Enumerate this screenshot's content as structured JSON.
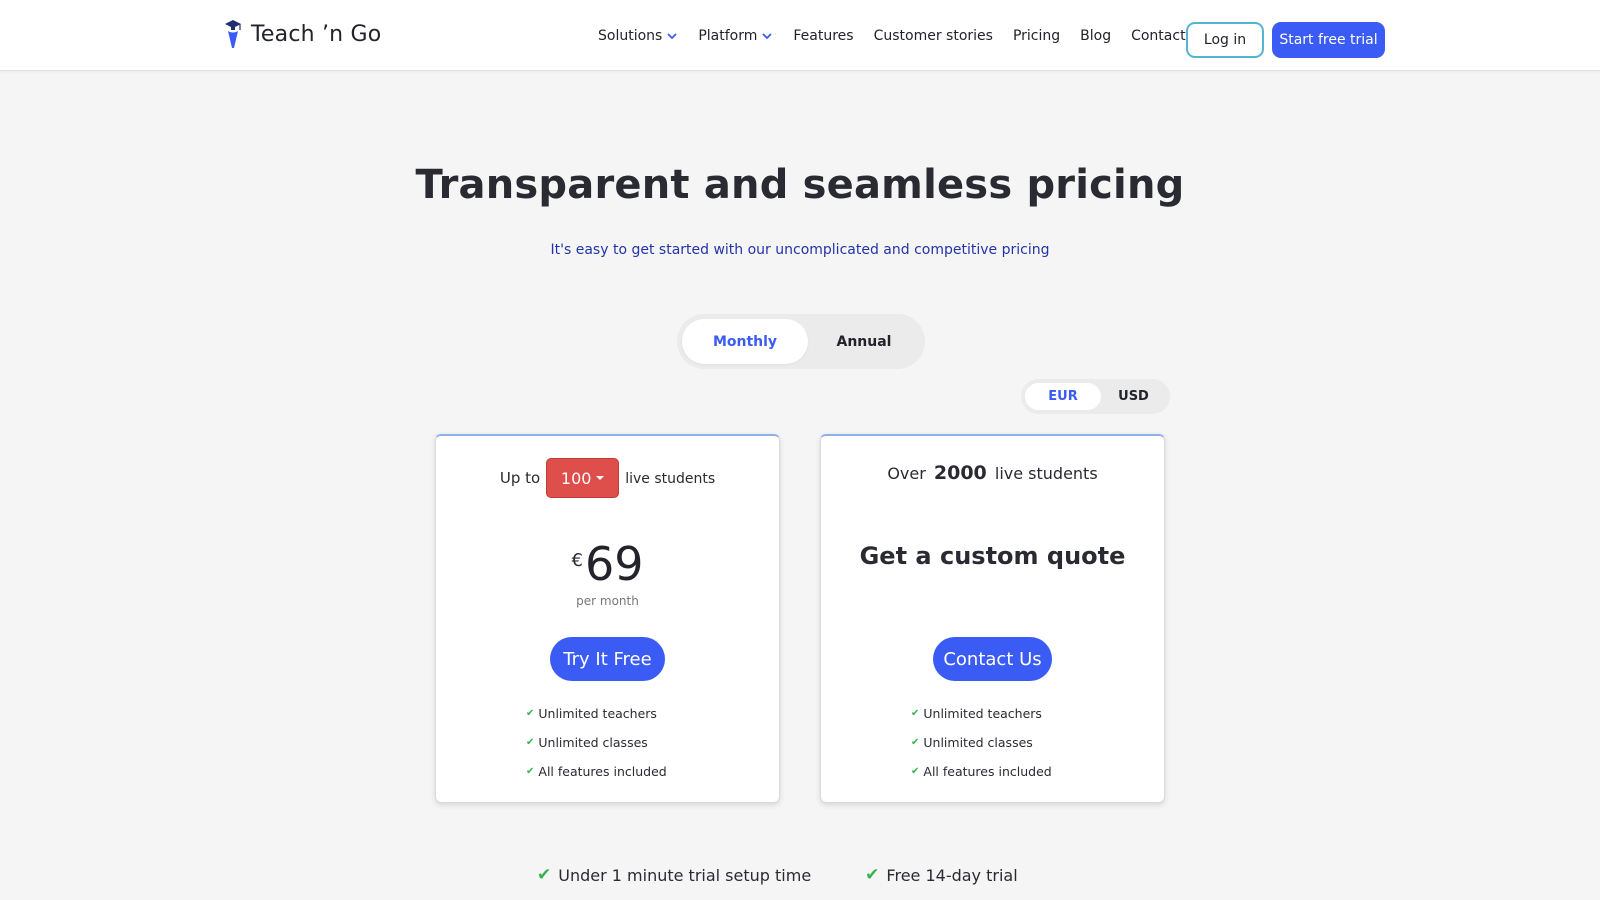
{
  "brand": {
    "name": "Teach ’n Go",
    "accent": "#3b5bf5"
  },
  "nav": {
    "items": [
      {
        "label": "Solutions",
        "dropdown": true
      },
      {
        "label": "Platform",
        "dropdown": true
      },
      {
        "label": "Features",
        "dropdown": false
      },
      {
        "label": "Customer stories",
        "dropdown": false
      },
      {
        "label": "Pricing",
        "dropdown": false
      },
      {
        "label": "Blog",
        "dropdown": false
      },
      {
        "label": "Contact",
        "dropdown": false
      }
    ],
    "login_label": "Log in",
    "trial_label": "Start free trial"
  },
  "hero": {
    "title": "Transparent and seamless pricing",
    "subtitle": "It's easy to get started with our uncomplicated and competitive pricing"
  },
  "billing": {
    "monthly": "Monthly",
    "annual": "Annual",
    "selected": "Monthly"
  },
  "currency": {
    "eur": "EUR",
    "usd": "USD",
    "selected": "EUR"
  },
  "plans": {
    "standard": {
      "prefix": "Up to",
      "students_value": "100",
      "suffix": "live students",
      "currency_symbol": "€",
      "price": "69",
      "period": "per month",
      "cta": "Try It Free",
      "features": [
        "Unlimited teachers",
        "Unlimited classes",
        "All features included"
      ]
    },
    "enterprise": {
      "prefix": "Over",
      "students_value": "2000",
      "suffix": "live students",
      "headline": "Get a custom quote",
      "cta": "Contact Us",
      "features": [
        "Unlimited teachers",
        "Unlimited classes",
        "All features included"
      ]
    }
  },
  "perks": [
    "Under 1 minute trial setup time",
    "Free 14-day trial"
  ],
  "icons": {
    "check": "✔",
    "small_check": "✔"
  }
}
